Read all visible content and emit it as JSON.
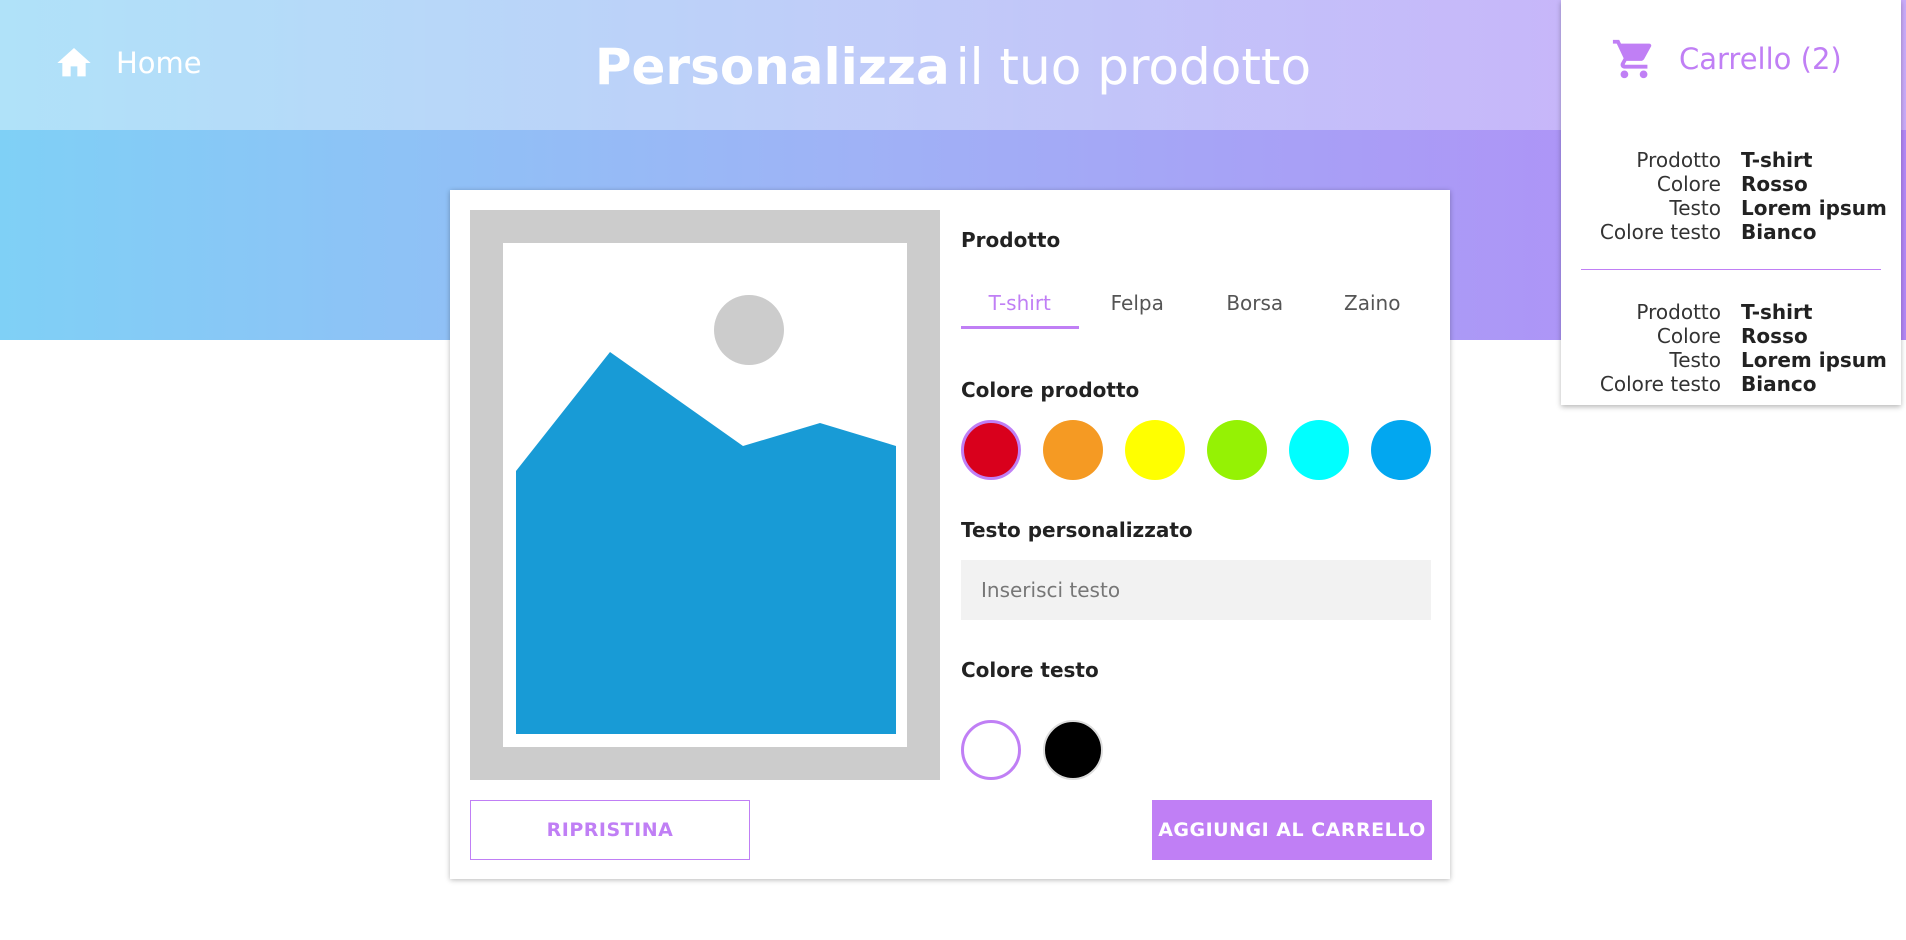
{
  "header": {
    "home_label": "Home",
    "title_strong": "Personalizza",
    "title_rest": "il tuo prodotto"
  },
  "cart": {
    "label": "Carrello (2)",
    "icon": "shopping-cart-icon",
    "items": [
      {
        "product_key": "Prodotto",
        "product": "T-shirt",
        "color_key": "Colore",
        "color": "Rosso",
        "text_key": "Testo",
        "text": "Lorem ipsum",
        "text_color_key": "Colore testo",
        "text_color": "Bianco"
      },
      {
        "product_key": "Prodotto",
        "product": "T-shirt",
        "color_key": "Colore",
        "color": "Rosso",
        "text_key": "Testo",
        "text": "Lorem ipsum",
        "text_color_key": "Colore testo",
        "text_color": "Bianco"
      }
    ]
  },
  "form": {
    "product_label": "Prodotto",
    "tabs": [
      "T-shirt",
      "Felpa",
      "Borsa",
      "Zaino"
    ],
    "active_tab": "T-shirt",
    "product_color_label": "Colore prodotto",
    "product_colors": [
      "#d9001c",
      "#f59a23",
      "#ffff00",
      "#95f204",
      "#00ffff",
      "#02a7f0"
    ],
    "custom_text_label": "Testo personalizzato",
    "custom_text_placeholder": "Inserisci testo",
    "custom_text_value": "",
    "text_color_label": "Colore testo",
    "text_colors": [
      "#ffffff",
      "#000000"
    ],
    "reset_label": "RIPRISTINA",
    "add_label": "AGGIUNGI AL CARRELLO"
  },
  "colors": {
    "accent": "#c07ff5",
    "preview_frame": "#cccccc",
    "preview_image": "#189bd6"
  }
}
